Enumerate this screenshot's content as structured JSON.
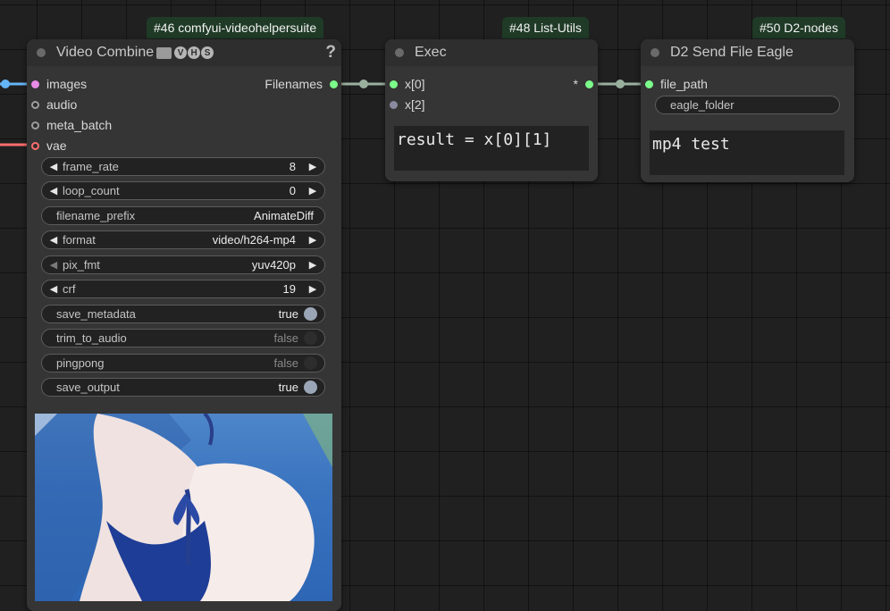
{
  "badges": {
    "n46": "#46 comfyui-videohelpersuite",
    "n48": "#48 List-Utils",
    "n50": "#50 D2-nodes"
  },
  "video_combine": {
    "title": "Video Combine",
    "help": "?",
    "vhs_letters": [
      "V",
      "H",
      "S"
    ],
    "inputs": [
      "images",
      "audio",
      "meta_batch",
      "vae"
    ],
    "output": "Filenames",
    "widgets": {
      "frame_rate": {
        "name": "frame_rate",
        "value": "8"
      },
      "loop_count": {
        "name": "loop_count",
        "value": "0"
      },
      "filename_prefix": {
        "name": "filename_prefix",
        "value": "AnimateDiff"
      },
      "format": {
        "name": "format",
        "value": "video/h264-mp4"
      },
      "pix_fmt": {
        "name": "pix_fmt",
        "value": "yuv420p"
      },
      "crf": {
        "name": "crf",
        "value": "19"
      },
      "save_metadata": {
        "name": "save_metadata",
        "value": "true"
      },
      "trim_to_audio": {
        "name": "trim_to_audio",
        "value": "false"
      },
      "pingpong": {
        "name": "pingpong",
        "value": "false"
      },
      "save_output": {
        "name": "save_output",
        "value": "true"
      }
    }
  },
  "exec": {
    "title": "Exec",
    "inputs": [
      "x[0]",
      "x[2]"
    ],
    "output": "*",
    "code": "result = x[0][1]"
  },
  "eagle": {
    "title": "D2 Send File Eagle",
    "input": "file_path",
    "folder_widget": "eagle_folder",
    "text": "mp4 test"
  },
  "colors": {
    "canvas": "#202020",
    "node_bg": "#353535",
    "badge_bg": "#1f3a26",
    "slot_image": "#64b5f6",
    "slot_vae": "#ff6e6e",
    "slot_string": "#7cfc8a",
    "slot_other": "#9e9e9e"
  }
}
